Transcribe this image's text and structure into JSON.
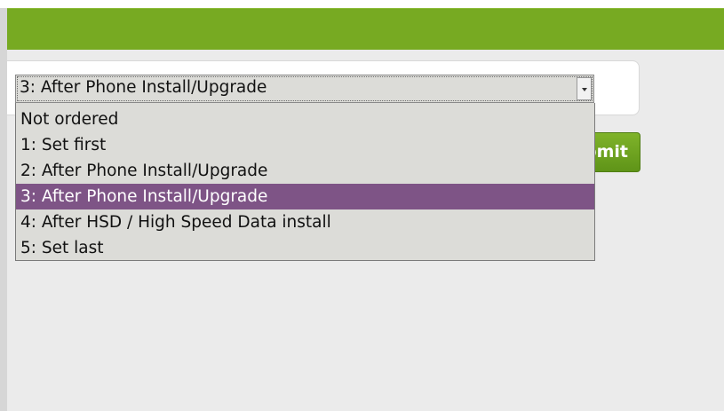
{
  "header": {
    "color": "#77aa22"
  },
  "form": {
    "select": {
      "value": "3: After Phone Install/Upgrade",
      "options": [
        {
          "label": "Not ordered",
          "selected": false
        },
        {
          "label": "1: Set first",
          "selected": false
        },
        {
          "label": "2: After Phone Install/Upgrade",
          "selected": false
        },
        {
          "label": "3: After Phone Install/Upgrade",
          "selected": true
        },
        {
          "label": "4: After HSD / High Speed Data install",
          "selected": false
        },
        {
          "label": "5: Set last",
          "selected": false
        }
      ],
      "highlight_color": "#7e5486"
    },
    "submit_label": "Submit"
  }
}
